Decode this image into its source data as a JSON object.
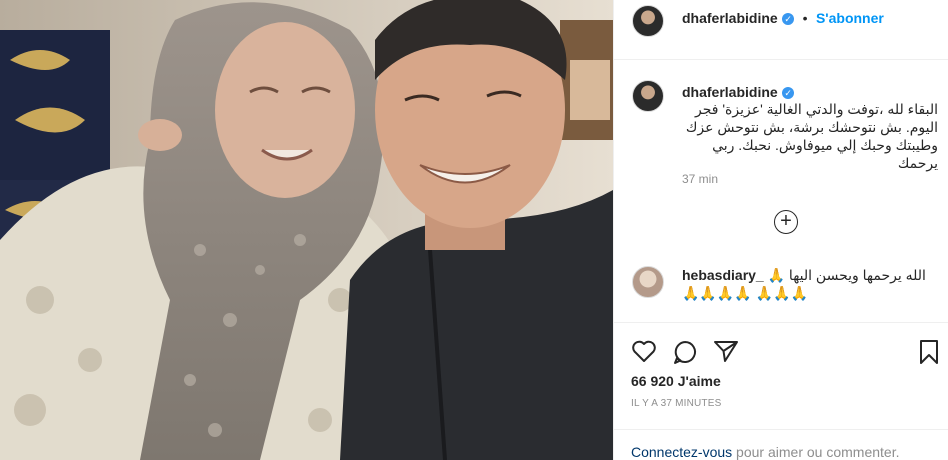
{
  "post": {
    "username": "dhaferlabidine",
    "verified_glyph": "✓",
    "dot": "•",
    "follow_label": "S'abonner",
    "caption": "البقاء لله ،توفت والدتي الغالية 'عزيزة' فجر اليوم. بش نتوحشك برشة، بش نتوحش عزك وطيبتك وحبك إلي ميوفاوش. نحبك. ربي يرحمك",
    "caption_time": "37 min",
    "load_more_glyph": "+",
    "comment": {
      "username": "hebasdiary_",
      "text": "الله يرحمها ويحسن اليها 🙏🙏🙏🙏 🙏🙏🙏🙏"
    },
    "likes": "66 920 J'aime",
    "time_ago": "IL Y A 37 MINUTES",
    "footer": {
      "login_link": "Connectez-vous",
      "rest": " pour aimer ou commenter."
    }
  },
  "icons": {
    "like": "heart-icon",
    "comment": "comment-icon",
    "share": "share-icon",
    "save": "bookmark-icon"
  },
  "colors": {
    "accent": "#0095f6",
    "verified": "#3897f0",
    "secondary_text": "#8e8e8e",
    "border": "#efefef"
  }
}
